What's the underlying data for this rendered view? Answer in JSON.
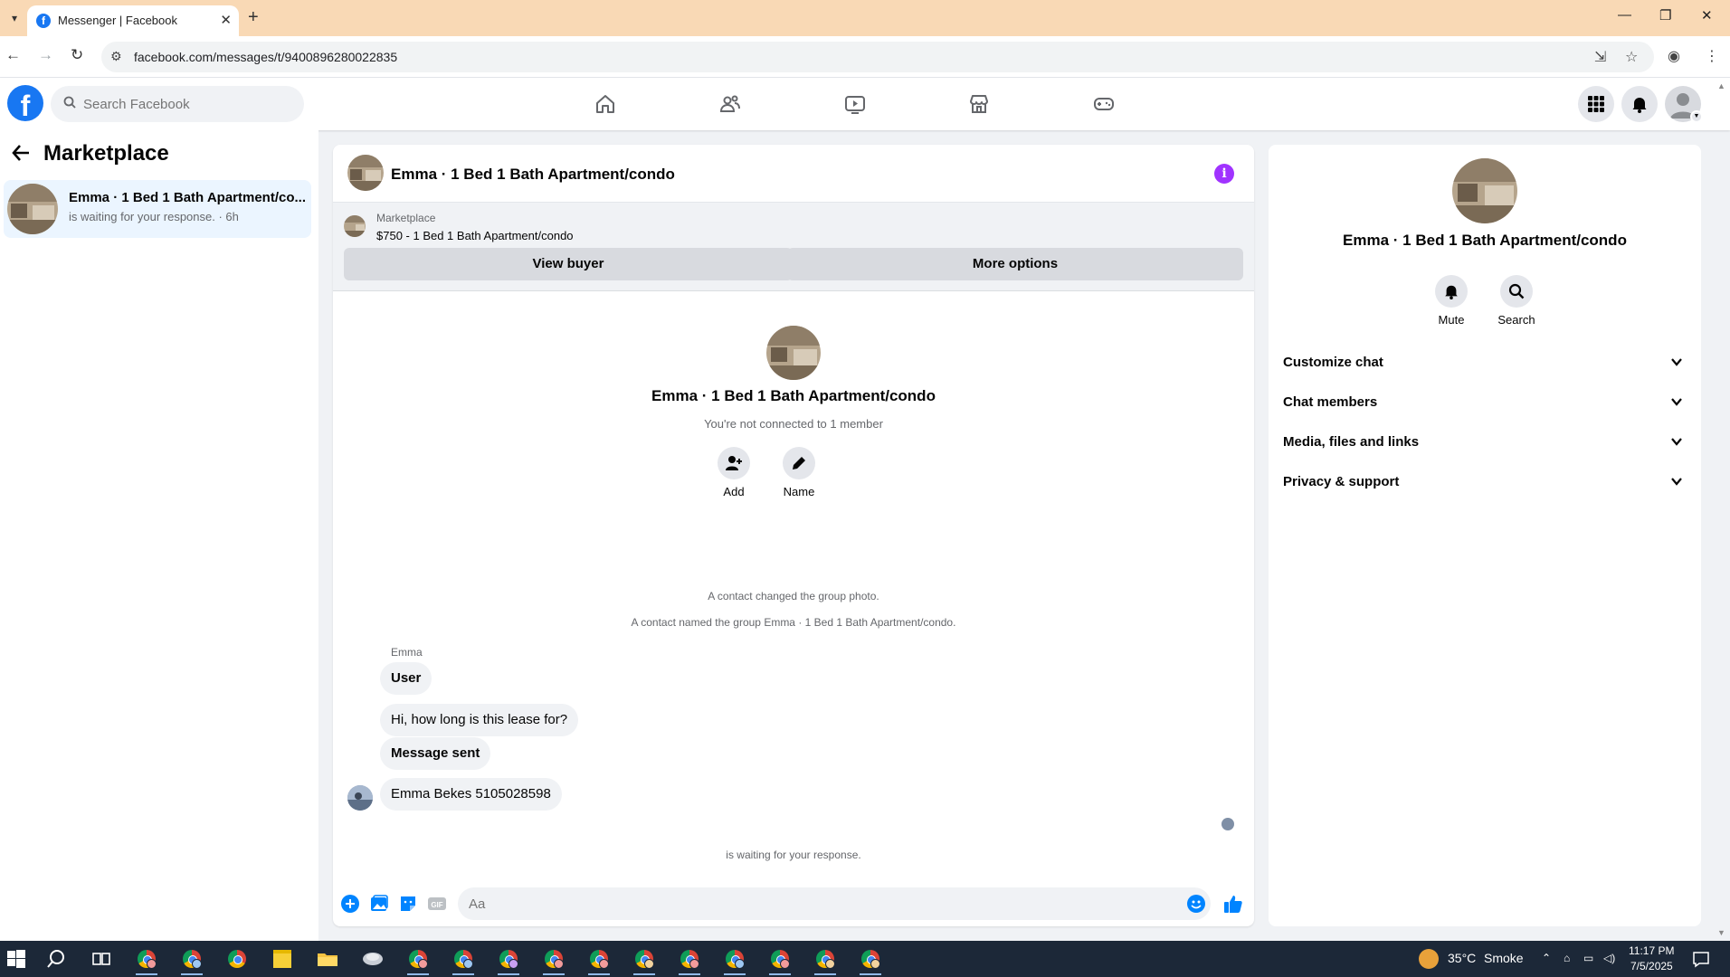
{
  "browser": {
    "tab_title": "Messenger | Facebook",
    "url": "facebook.com/messages/t/9400896280022835"
  },
  "fb": {
    "search_placeholder": "Search Facebook"
  },
  "left": {
    "title": "Marketplace",
    "conversation": {
      "name": "Emma · 1 Bed 1 Bath Apartment/co...",
      "subtitle": "is waiting for your response. · 6h"
    }
  },
  "chat": {
    "title": "Emma · 1 Bed 1 Bath Apartment/condo",
    "marketplace_label": "Marketplace",
    "listing": "$750 - 1 Bed 1 Bath Apartment/condo",
    "view_buyer": "View buyer",
    "more_options": "More options",
    "intro_name": "Emma · 1 Bed 1 Bath Apartment/condo",
    "intro_sub": "You're not connected to 1 member",
    "add_label": "Add",
    "name_label": "Name",
    "system_messages": [
      "A contact changed the group photo.",
      "A contact named the group Emma · 1 Bed 1 Bath Apartment/condo."
    ],
    "sender": "Emma",
    "messages": [
      "User",
      "Hi, how long is this lease for?",
      "Message sent",
      "Emma Bekes 5105028598"
    ],
    "waiting": "is waiting for your response.",
    "composer_placeholder": "Aa",
    "composer_icons": [
      "plus-icon",
      "image-icon",
      "sticker-icon",
      "gif-icon",
      "emoji-icon",
      "thumbs-up-icon"
    ],
    "gif_label": "GIF"
  },
  "right": {
    "name": "Emma · 1 Bed 1 Bath Apartment/condo",
    "mute_label": "Mute",
    "search_label": "Search",
    "sections": [
      "Customize chat",
      "Chat members",
      "Media, files and links",
      "Privacy & support"
    ]
  },
  "taskbar": {
    "temperature": "35°C",
    "weather": "Smoke",
    "time": "11:17 PM",
    "date": "7/5/2025"
  },
  "colors": {
    "fb_blue": "#1877f2",
    "messenger_blue": "#0084ff",
    "info_purple": "#a033ff",
    "tab_strip": "#f9d9b5",
    "taskbar": "#1c2838"
  }
}
